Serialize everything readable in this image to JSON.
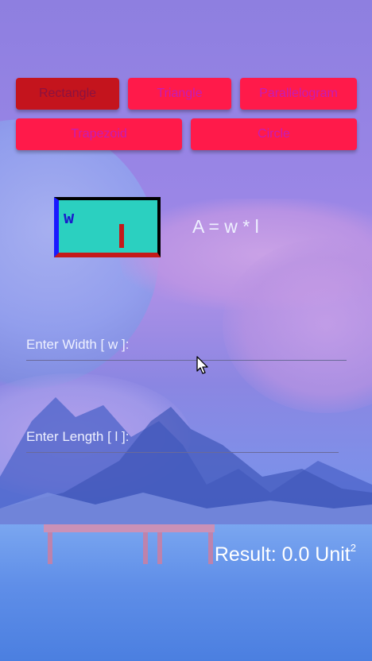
{
  "shape_buttons": [
    {
      "label": "Rectangle",
      "active": true
    },
    {
      "label": "Triangle",
      "active": false
    },
    {
      "label": "Parallelogram",
      "active": false
    },
    {
      "label": "Trapezoid",
      "active": false
    },
    {
      "label": "Circle",
      "active": false
    }
  ],
  "figure": {
    "width_symbol": "w",
    "length_symbol": "l"
  },
  "formula": "A = w * l",
  "inputs": {
    "width_label": "Enter Width [ w ]:",
    "length_label": "Enter Length [ l ]:",
    "width_value": "",
    "length_value": ""
  },
  "result": {
    "prefix": "Result: 0.0 Unit",
    "exponent": "2"
  },
  "colors": {
    "button": "#ff1a4a",
    "button_active": "#c4141d",
    "button_text": "#c51cb6",
    "figure_fill": "#2bd0c0"
  },
  "icons": {
    "cursor": "mouse-pointer-icon"
  }
}
